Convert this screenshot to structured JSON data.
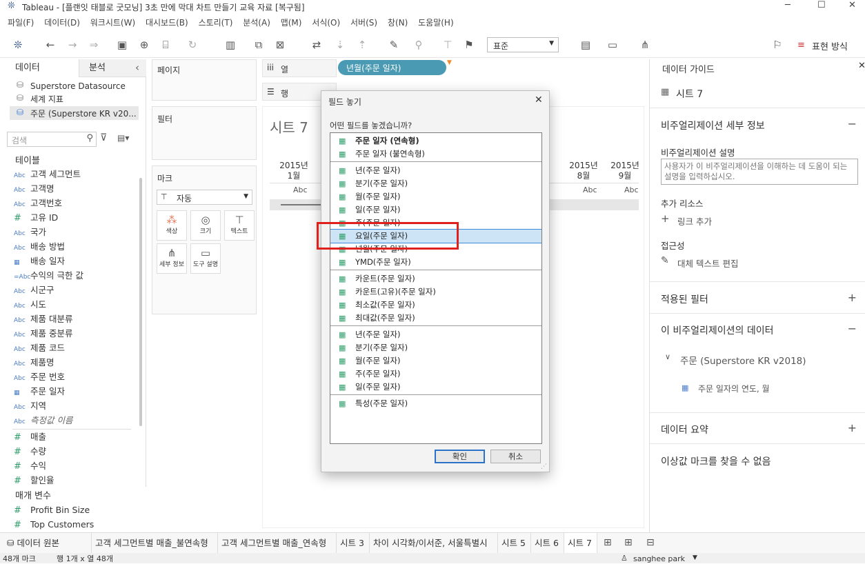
{
  "window": {
    "title": "Tableau - [플랜잇 태블로 굿모닝] 3초 만에 막대 차트 만들기 교육 자료 [복구됨]",
    "app_icon": "tableau-logo-icon",
    "controls": [
      "─",
      "☐",
      "✕"
    ]
  },
  "menu": [
    "파일(F)",
    "데이터(D)",
    "워크시트(W)",
    "대시보드(B)",
    "스토리(T)",
    "분석(A)",
    "맵(M)",
    "서식(O)",
    "서버(S)",
    "창(N)",
    "도움말(H)"
  ],
  "toolbar": {
    "fit": "표준",
    "show_me": "표현 방식"
  },
  "left_panel": {
    "tab_data": "데이터",
    "tab_analysis": "분석",
    "collapse": "‹",
    "datasources": [
      "Superstore Datasource",
      "세계 지표",
      "주문 (Superstore KR v20..."
    ],
    "search_placeholder": "검색",
    "tables_header": "테이블",
    "dimensions": [
      {
        "type": "Abc",
        "name": "고객 세그먼트"
      },
      {
        "type": "Abc",
        "name": "고객명"
      },
      {
        "type": "Abc",
        "name": "고객번호"
      },
      {
        "type": "#",
        "name": "고유 ID"
      },
      {
        "type": "Abc",
        "name": "국가"
      },
      {
        "type": "Abc",
        "name": "배송 방법"
      },
      {
        "type": "cal",
        "name": "배송 일자"
      },
      {
        "type": "=Abc",
        "name": "수익의 극한 값"
      },
      {
        "type": "Abc",
        "name": "시군구"
      },
      {
        "type": "Abc",
        "name": "시도"
      },
      {
        "type": "Abc",
        "name": "제품 대분류"
      },
      {
        "type": "Abc",
        "name": "제품 중분류"
      },
      {
        "type": "Abc",
        "name": "제품 코드"
      },
      {
        "type": "Abc",
        "name": "제품명"
      },
      {
        "type": "Abc",
        "name": "주문 번호"
      },
      {
        "type": "cal",
        "name": "주문 일자"
      },
      {
        "type": "Abc",
        "name": "지역"
      },
      {
        "type": "Abc",
        "name": "측정값 이름"
      }
    ],
    "measures": [
      {
        "type": "#",
        "name": "매출"
      },
      {
        "type": "#",
        "name": "수량"
      },
      {
        "type": "#",
        "name": "수익"
      },
      {
        "type": "#",
        "name": "할인율"
      }
    ],
    "params_header": "매개 변수",
    "params": [
      {
        "type": "#",
        "name": "Profit Bin Size"
      },
      {
        "type": "#",
        "name": "Top Customers"
      }
    ]
  },
  "cards": {
    "pages": "페이지",
    "filters": "필터",
    "marks": "마크",
    "mark_type": "자동",
    "mark_buttons": [
      "색상",
      "크기",
      "텍스트",
      "세부 정보",
      "도구 설명"
    ]
  },
  "shelves": {
    "columns_label": "열",
    "rows_label": "행",
    "column_pill": "년월(주문 일자)"
  },
  "sheet": {
    "title": "시트 7",
    "headers": [
      {
        "year": "2015년",
        "month": "1월"
      },
      {
        "year": "2015년",
        "month": "8월"
      },
      {
        "year": "2015년",
        "month": "9월"
      }
    ],
    "cell": "Abc"
  },
  "dialog": {
    "title": "필드 놓기",
    "question": "어떤 필드를 놓겠습니까?",
    "ok": "확인",
    "cancel": "취소",
    "groups": [
      [
        "주문 일자 (연속형)",
        "주문 일자 (불연속형)"
      ],
      [
        "년(주문 일자)",
        "분기(주문 일자)",
        "월(주문 일자)",
        "일(주문 일자)",
        "주(주문 일자)",
        "요일(주문 일자)",
        "년월(주문 일자)",
        "YMD(주문 일자)"
      ],
      [
        "카운트(주문 일자)",
        "카운트(고유)(주문 일자)",
        "최소값(주문 일자)",
        "최대값(주문 일자)"
      ],
      [
        "년(주문 일자)",
        "분기(주문 일자)",
        "월(주문 일자)",
        "주(주문 일자)",
        "일(주문 일자)"
      ],
      [
        "특성(주문 일자)"
      ]
    ],
    "selected": "요일(주문 일자)"
  },
  "right_panel": {
    "header": "데이터 가이드",
    "sheet_name": "시트 7",
    "viz_details": "비주얼리제이션 세부 정보",
    "viz_desc_label": "비주얼리제이션 설명",
    "viz_desc_placeholder": "사용자가 이 비주얼리제이션을 이해하는 데 도움이 되는 설명을 입력하십시오.",
    "resources_label": "추가 리소스",
    "add_link": "링크 추가",
    "accessibility": "접근성",
    "alt_text": "대체 텍스트 편집",
    "applied_filters": "적용된 필터",
    "viz_data": "이 비주얼리제이션의 데이터",
    "datasource": "주문 (Superstore KR v2018)",
    "field": "주문 일자의 연도, 월",
    "data_summary": "데이터 요약",
    "outliers": "이상값 마크를 찾을 수 없음"
  },
  "sheet_tabs": {
    "data_source": "데이터 원본",
    "tabs": [
      "고객 세그먼트별 매출_불연속형",
      "고객 세그먼트별 매출_연속형",
      "시트 3",
      "차이 시각화/이서준, 서울특별시",
      "시트 5",
      "시트 6",
      "시트 7"
    ],
    "active": "시트 7"
  },
  "status": {
    "marks": "48개 마크",
    "rows_cols": "행 1개 x 열 48개",
    "user": "sanghee park"
  },
  "colors": {
    "pill": "#4b9ab3",
    "highlight": "#e0201c",
    "selected": "#cde4f7"
  }
}
